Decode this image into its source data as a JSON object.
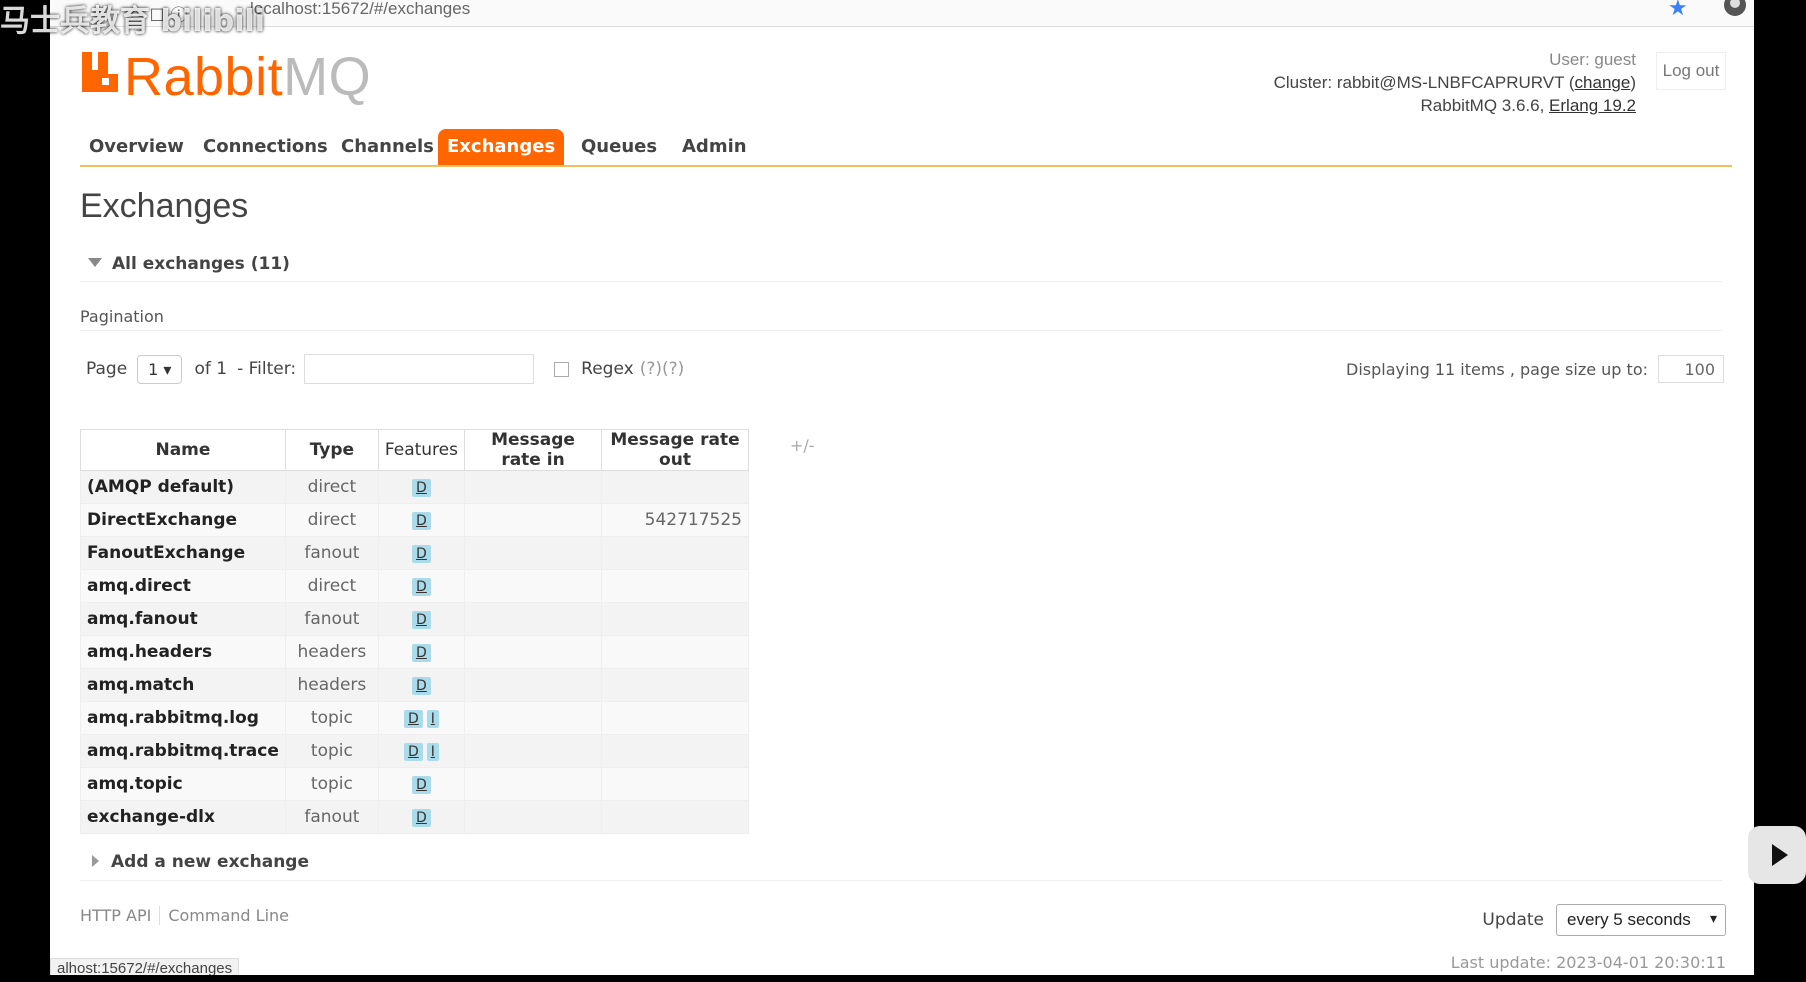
{
  "browser": {
    "url": "localhost:15672/#/exchanges",
    "status_url": "alhost:15672/#/exchanges"
  },
  "overlay": {
    "watermark": "马士兵教育 bilibili"
  },
  "header": {
    "logo_text_a": "Rabbit",
    "logo_text_b": "MQ",
    "user_label": "User: guest",
    "cluster_prefix": "Cluster: rabbit@MS-LNBFCAPRURVT (",
    "cluster_change": "change",
    "cluster_suffix": ")",
    "version_prefix": "RabbitMQ 3.6.6, ",
    "erlang": "Erlang 19.2",
    "logout": "Log out"
  },
  "tabs": [
    "Overview",
    "Connections",
    "Channels",
    "Exchanges",
    "Queues",
    "Admin"
  ],
  "active_tab": "Exchanges",
  "page_title": "Exchanges",
  "section_title": "All exchanges (11)",
  "pagination": {
    "label": "Pagination",
    "page_label": "Page",
    "page_value": "1",
    "of_label": "of 1",
    "filter_label": "- Filter:",
    "regex_label": "Regex",
    "regex_help": "(?)(?)",
    "display_text": "Displaying 11 items , page size up to:",
    "page_size": "100"
  },
  "table": {
    "columns": [
      "Name",
      "Type",
      "Features",
      "Message rate in",
      "Message rate out"
    ],
    "plus_minus": "+/-",
    "rows": [
      {
        "name": "(AMQP default)",
        "type": "direct",
        "features": [
          "D"
        ],
        "rate_in": "",
        "rate_out": ""
      },
      {
        "name": "DirectExchange",
        "type": "direct",
        "features": [
          "D"
        ],
        "rate_in": "",
        "rate_out": "542717525"
      },
      {
        "name": "FanoutExchange",
        "type": "fanout",
        "features": [
          "D"
        ],
        "rate_in": "",
        "rate_out": ""
      },
      {
        "name": "amq.direct",
        "type": "direct",
        "features": [
          "D"
        ],
        "rate_in": "",
        "rate_out": ""
      },
      {
        "name": "amq.fanout",
        "type": "fanout",
        "features": [
          "D"
        ],
        "rate_in": "",
        "rate_out": ""
      },
      {
        "name": "amq.headers",
        "type": "headers",
        "features": [
          "D"
        ],
        "rate_in": "",
        "rate_out": ""
      },
      {
        "name": "amq.match",
        "type": "headers",
        "features": [
          "D"
        ],
        "rate_in": "",
        "rate_out": ""
      },
      {
        "name": "amq.rabbitmq.log",
        "type": "topic",
        "features": [
          "D",
          "I"
        ],
        "rate_in": "",
        "rate_out": ""
      },
      {
        "name": "amq.rabbitmq.trace",
        "type": "topic",
        "features": [
          "D",
          "I"
        ],
        "rate_in": "",
        "rate_out": ""
      },
      {
        "name": "amq.topic",
        "type": "topic",
        "features": [
          "D"
        ],
        "rate_in": "",
        "rate_out": ""
      },
      {
        "name": "exchange-dlx",
        "type": "fanout",
        "features": [
          "D"
        ],
        "rate_in": "",
        "rate_out": ""
      }
    ]
  },
  "add_exchange": "Add a new exchange",
  "footer": {
    "http_api": "HTTP API",
    "command_line": "Command Line",
    "update_label": "Update",
    "update_value": "every 5 seconds",
    "last_update": "Last update: 2023-04-01 20:30:11"
  },
  "colors": {
    "brand": "#ff6600",
    "tab_underline": "#f0c060",
    "feature_badge": "#a9dbea"
  }
}
